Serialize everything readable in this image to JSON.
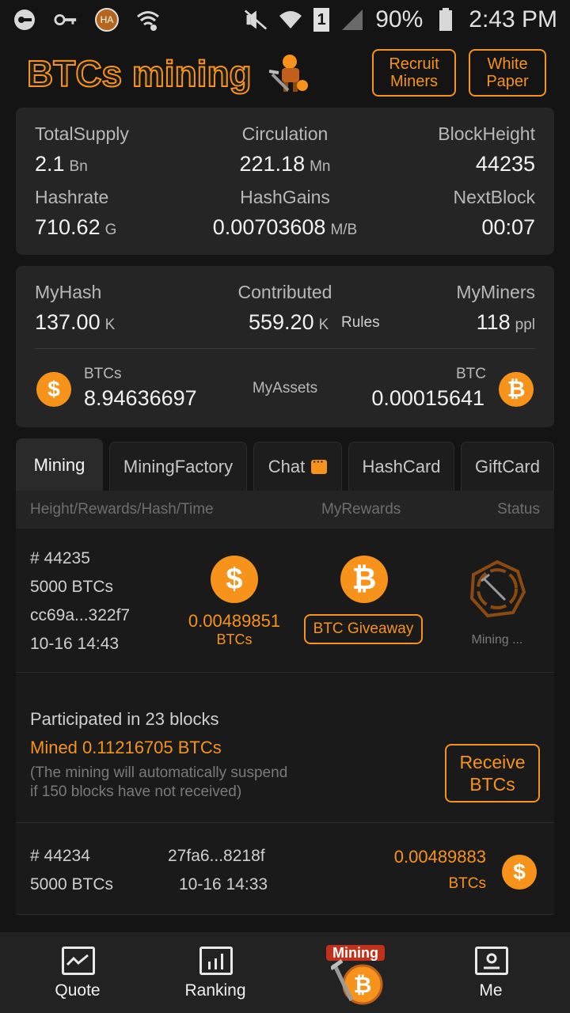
{
  "status_bar": {
    "battery": "90%",
    "time": "2:43 PM",
    "sim": "1",
    "app_badge": "HA"
  },
  "header": {
    "logo_text": "BTCs mining",
    "recruit_label": "Recruit Miners",
    "whitepaper_label": "White Paper"
  },
  "stats": {
    "total_supply_label": "TotalSupply",
    "total_supply_value": "2.1",
    "total_supply_unit": "Bn",
    "circulation_label": "Circulation",
    "circulation_value": "221.18",
    "circulation_unit": "Mn",
    "block_height_label": "BlockHeight",
    "block_height_value": "44235",
    "hashrate_label": "Hashrate",
    "hashrate_value": "710.62",
    "hashrate_unit": "G",
    "hashgains_label": "HashGains",
    "hashgains_value": "0.00703608",
    "hashgains_unit": "M/B",
    "nextblock_label": "NextBlock",
    "nextblock_value": "00:07"
  },
  "mine": {
    "myhash_label": "MyHash",
    "myhash_value": "137.00",
    "myhash_unit": "K",
    "contributed_label": "Contributed",
    "contributed_value": "559.20",
    "contributed_unit": "K",
    "rules_label": "Rules",
    "myminers_label": "MyMiners",
    "myminers_value": "118",
    "myminers_unit": "ppl",
    "btcs_label": "BTCs",
    "btcs_value": "8.94636697",
    "myassets_label": "MyAssets",
    "btc_label": "BTC",
    "btc_value": "0.00015641"
  },
  "tabs": [
    "Mining",
    "MiningFactory",
    "Chat",
    "HashCard",
    "GiftCard"
  ],
  "table_head": {
    "col1": "Height/Rewards/Hash/Time",
    "col2": "MyRewards",
    "col3": "Status"
  },
  "current_block": {
    "height": "# 44235",
    "reward": "5000 BTCs",
    "hash": "cc69a...322f7",
    "time": "10-16 14:43",
    "my_reward": "0.00489851",
    "my_reward_unit": "BTCs",
    "giveaway_label": "BTC Giveaway",
    "status": "Mining ..."
  },
  "participation": {
    "participated": "Participated in 23 blocks",
    "mined": "Mined 0.11216705 BTCs",
    "note_line1": "(The mining will automatically suspend",
    "note_line2": "if 150 blocks have not received)",
    "receive_label": "Receive BTCs"
  },
  "prev_block": {
    "height": "# 44234",
    "reward": "5000 BTCs",
    "hash": "27fa6...8218f",
    "time": "10-16 14:33",
    "my_reward": "0.00489883",
    "my_reward_unit": "BTCs"
  },
  "bottom_nav": {
    "quote": "Quote",
    "ranking": "Ranking",
    "mining": "Mining",
    "me": "Me"
  },
  "colors": {
    "accent": "#f7931a",
    "background": "#141414",
    "card": "#252525"
  }
}
